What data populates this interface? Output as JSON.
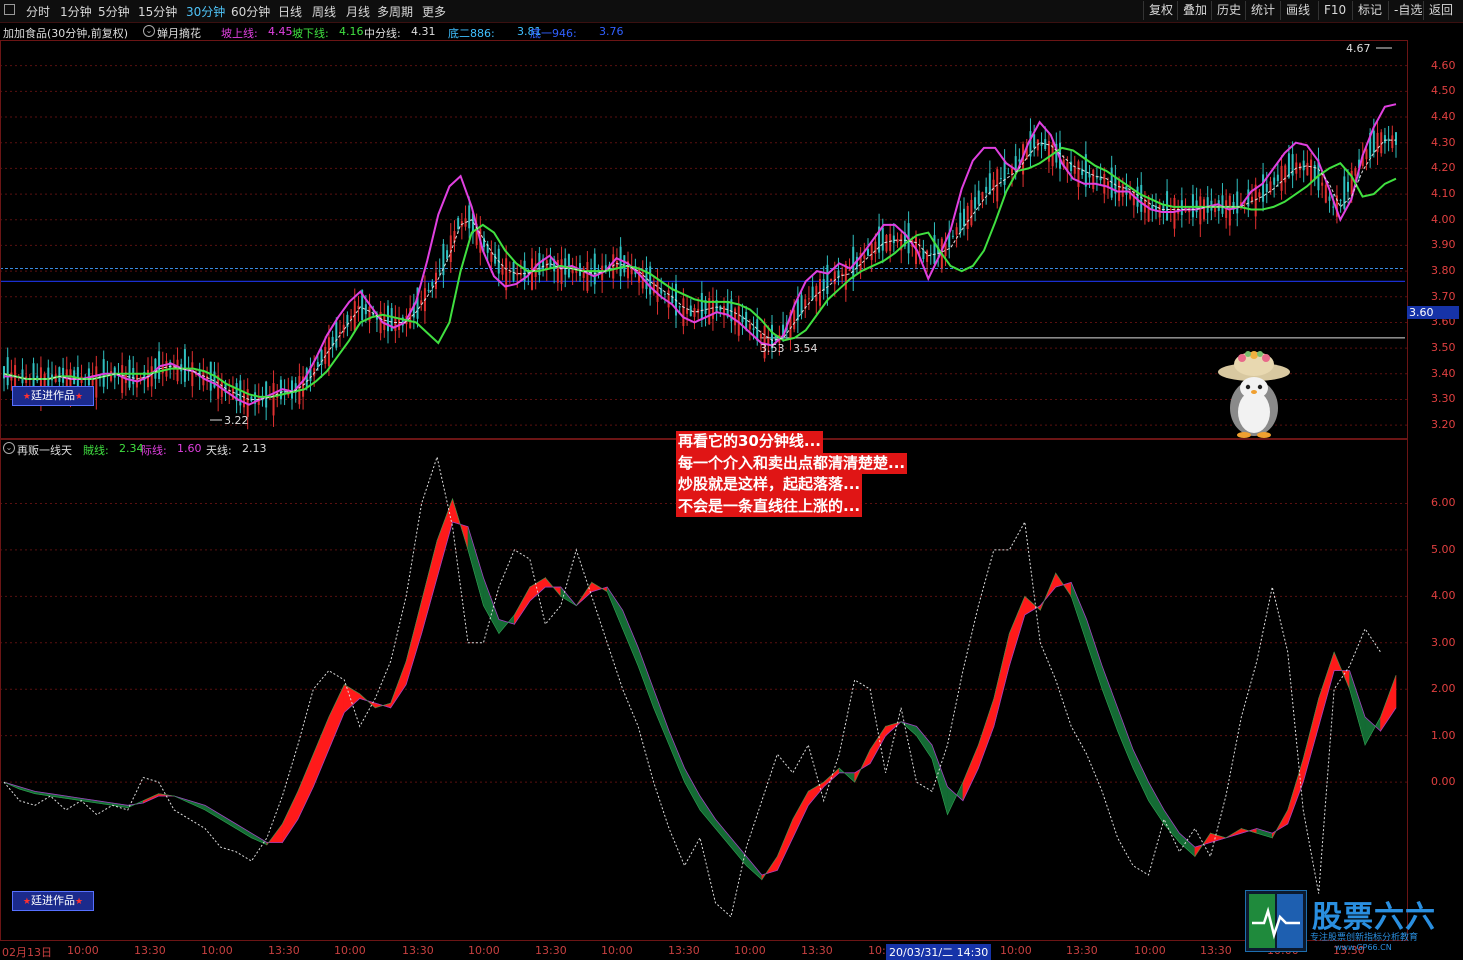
{
  "toolbar": {
    "periods": [
      "分时",
      "1分钟",
      "5分钟",
      "15分钟",
      "30分钟",
      "60分钟",
      "日线",
      "周线",
      "月线",
      "多周期",
      "更多"
    ],
    "active_period": "30分钟",
    "right_buttons": [
      "复权",
      "叠加",
      "历史",
      "统计",
      "画线",
      "F10",
      "标记",
      "-自选",
      "返回"
    ]
  },
  "info_bar": {
    "title": "加加食品(30分钟,前复权)",
    "indicator": "婵月摘花",
    "items": [
      {
        "label": "坡上线:",
        "value": "4.45",
        "color": "#e040e0"
      },
      {
        "label": "坡下线:",
        "value": "4.16",
        "color": "#40e040"
      },
      {
        "label": "中分线:",
        "value": "4.31",
        "color": "#dddddd"
      },
      {
        "label": "底二886:",
        "value": "3.81",
        "color": "#40c0ff"
      },
      {
        "label": "底一946:",
        "value": "3.76",
        "color": "#3060ff"
      }
    ]
  },
  "osc_info": {
    "title": "再贩一线天",
    "items": [
      {
        "label": "賊线:",
        "value": "2.34",
        "color": "#40e040"
      },
      {
        "label": "际线:",
        "value": "1.60",
        "color": "#e040e0"
      },
      {
        "label": "天线:",
        "value": "2.13",
        "color": "#dddddd"
      }
    ]
  },
  "annotation": [
    "再看它的30分钟线...",
    "每一个介入和卖出点都清清楚楚...",
    "炒股就是这样，起起落落...",
    "不会是一条直线往上涨的..."
  ],
  "brand_label": "廷进作品",
  "price_tag": "3.60",
  "high_label": "4.67",
  "low_label": "3.22",
  "mid_labels": [
    "3.53",
    "3.54"
  ],
  "logo": {
    "name": "股票六六",
    "subtitle": "专注股票创新指标分析教育",
    "url": "www.GP66.CN"
  },
  "colors": {
    "up": "#ff2020",
    "down": "#1a7a3a",
    "magenta": "#e040e0",
    "green": "#40e040",
    "white_dash": "#dddddd",
    "grid": "#6b1515",
    "blue_line": "#1a2fd0"
  },
  "chart_data": [
    {
      "type": "line",
      "title": "加加食品(30分钟,前复权)",
      "ylim": [
        3.15,
        4.7
      ],
      "y_ticks": [
        "4.60",
        "4.50",
        "4.40",
        "4.30",
        "4.20",
        "4.10",
        "4.00",
        "3.90",
        "3.80",
        "3.70",
        "3.60",
        "3.50",
        "3.40",
        "3.30",
        "3.20"
      ],
      "x_ticks": [
        "02月13日",
        "10:00",
        "13:30",
        "10:00",
        "13:30",
        "10:00",
        "13:30",
        "10:00",
        "13:30",
        "10:00",
        "13:30",
        "10:00",
        "13:30",
        "10:",
        "20/03/31/二 14:30",
        "10:00",
        "13:30",
        "10:00",
        "13:30",
        "10:00",
        "13:30",
        "10:00",
        "13:30",
        "10:00",
        "13:30"
      ],
      "series": [
        {
          "name": "坡上线",
          "color": "#e040e0",
          "values": [
            3.39,
            3.39,
            3.38,
            3.38,
            3.38,
            3.39,
            3.38,
            3.38,
            3.39,
            3.4,
            3.4,
            3.38,
            3.37,
            3.39,
            3.43,
            3.44,
            3.42,
            3.41,
            3.38,
            3.36,
            3.33,
            3.3,
            3.28,
            3.3,
            3.32,
            3.34,
            3.33,
            3.38,
            3.46,
            3.55,
            3.62,
            3.68,
            3.72,
            3.66,
            3.6,
            3.58,
            3.6,
            3.68,
            3.84,
            4.02,
            4.13,
            4.17,
            4.05,
            3.88,
            3.78,
            3.74,
            3.75,
            3.78,
            3.83,
            3.86,
            3.81,
            3.82,
            3.8,
            3.78,
            3.8,
            3.85,
            3.83,
            3.79,
            3.74,
            3.7,
            3.67,
            3.62,
            3.6,
            3.62,
            3.64,
            3.63,
            3.6,
            3.56,
            3.52,
            3.51,
            3.55,
            3.67,
            3.76,
            3.8,
            3.79,
            3.83,
            3.81,
            3.86,
            3.92,
            3.98,
            3.98,
            3.94,
            3.88,
            3.77,
            3.86,
            3.96,
            4.12,
            4.23,
            4.28,
            4.28,
            4.22,
            4.19,
            4.3,
            4.38,
            4.33,
            4.22,
            4.16,
            4.14,
            4.14,
            4.13,
            4.11,
            4.11,
            4.07,
            4.04,
            4.03,
            4.03,
            4.04,
            4.04,
            4.05,
            4.06,
            4.04,
            4.05,
            4.11,
            4.14,
            4.2,
            4.26,
            4.3,
            4.29,
            4.23,
            4.12,
            4.0,
            4.08,
            4.25,
            4.36,
            4.44,
            4.45
          ]
        },
        {
          "name": "坡下线",
          "color": "#40e040",
          "values": [
            3.4,
            3.39,
            3.38,
            3.38,
            3.38,
            3.39,
            3.39,
            3.38,
            3.38,
            3.39,
            3.4,
            3.4,
            3.4,
            3.4,
            3.41,
            3.42,
            3.42,
            3.42,
            3.41,
            3.39,
            3.36,
            3.34,
            3.32,
            3.31,
            3.31,
            3.32,
            3.33,
            3.34,
            3.37,
            3.41,
            3.47,
            3.53,
            3.6,
            3.62,
            3.63,
            3.62,
            3.61,
            3.6,
            3.56,
            3.52,
            3.6,
            3.8,
            3.95,
            3.98,
            3.95,
            3.88,
            3.83,
            3.8,
            3.8,
            3.81,
            3.82,
            3.81,
            3.8,
            3.8,
            3.8,
            3.81,
            3.82,
            3.81,
            3.79,
            3.76,
            3.73,
            3.71,
            3.69,
            3.68,
            3.68,
            3.68,
            3.67,
            3.65,
            3.61,
            3.56,
            3.53,
            3.54,
            3.57,
            3.63,
            3.69,
            3.73,
            3.77,
            3.8,
            3.82,
            3.84,
            3.87,
            3.91,
            3.94,
            3.95,
            3.88,
            3.82,
            3.8,
            3.82,
            3.88,
            3.99,
            4.11,
            4.19,
            4.2,
            4.22,
            4.25,
            4.28,
            4.27,
            4.24,
            4.21,
            4.19,
            4.16,
            4.13,
            4.1,
            4.08,
            4.06,
            4.05,
            4.05,
            4.05,
            4.05,
            4.05,
            4.05,
            4.05,
            4.04,
            4.04,
            4.05,
            4.07,
            4.1,
            4.13,
            4.17,
            4.2,
            4.22,
            4.17,
            4.09,
            4.1,
            4.14,
            4.16
          ]
        },
        {
          "name": "中分线",
          "color": "#dddddd",
          "values": [
            3.4,
            3.39,
            3.38,
            3.38,
            3.38,
            3.39,
            3.38,
            3.38,
            3.38,
            3.39,
            3.4,
            3.39,
            3.38,
            3.39,
            3.42,
            3.43,
            3.42,
            3.41,
            3.39,
            3.37,
            3.34,
            3.32,
            3.3,
            3.3,
            3.31,
            3.33,
            3.33,
            3.36,
            3.41,
            3.48,
            3.54,
            3.6,
            3.66,
            3.64,
            3.61,
            3.6,
            3.6,
            3.64,
            3.7,
            3.77,
            3.86,
            3.98,
            4.0,
            3.93,
            3.86,
            3.81,
            3.79,
            3.79,
            3.81,
            3.83,
            3.81,
            3.81,
            3.8,
            3.79,
            3.8,
            3.83,
            3.82,
            3.8,
            3.76,
            3.73,
            3.7,
            3.66,
            3.64,
            3.65,
            3.66,
            3.65,
            3.63,
            3.6,
            3.56,
            3.53,
            3.54,
            3.6,
            3.66,
            3.71,
            3.74,
            3.78,
            3.79,
            3.83,
            3.87,
            3.91,
            3.92,
            3.92,
            3.91,
            3.86,
            3.87,
            3.89,
            3.96,
            4.02,
            4.08,
            4.13,
            4.16,
            4.19,
            4.25,
            4.3,
            4.29,
            4.25,
            4.21,
            4.19,
            4.17,
            4.16,
            4.13,
            4.12,
            4.09,
            4.06,
            4.04,
            4.04,
            4.04,
            4.04,
            4.05,
            4.05,
            4.05,
            4.05,
            4.07,
            4.09,
            4.12,
            4.16,
            4.2,
            4.21,
            4.2,
            4.14,
            4.05,
            4.09,
            4.19,
            4.26,
            4.31,
            4.31
          ]
        }
      ]
    },
    {
      "type": "area",
      "title": "再贩一线天",
      "ylim": [
        -3.4,
        7.0
      ],
      "y_ticks": [
        "6.00",
        "5.00",
        "4.00",
        "3.00",
        "2.00",
        "1.00",
        "0.00"
      ],
      "series": [
        {
          "name": "賊线",
          "color": "#40e040",
          "values": [
            0.0,
            -0.15,
            -0.25,
            -0.3,
            -0.35,
            -0.4,
            -0.45,
            -0.5,
            -0.55,
            -0.4,
            -0.25,
            -0.3,
            -0.45,
            -0.6,
            -0.8,
            -1.0,
            -1.2,
            -1.35,
            -0.9,
            -0.2,
            0.6,
            1.4,
            2.1,
            1.9,
            1.6,
            1.7,
            2.6,
            3.9,
            5.2,
            6.1,
            5.0,
            3.8,
            3.2,
            3.6,
            4.2,
            4.4,
            4.0,
            3.8,
            4.3,
            4.1,
            3.3,
            2.5,
            1.6,
            0.8,
            0.0,
            -0.6,
            -1.0,
            -1.4,
            -1.8,
            -2.1,
            -1.6,
            -0.8,
            -0.2,
            0.0,
            0.3,
            0.0,
            0.7,
            1.2,
            1.3,
            1.0,
            0.5,
            -0.7,
            0.0,
            0.8,
            1.8,
            3.2,
            4.0,
            3.7,
            4.5,
            4.0,
            3.0,
            2.0,
            1.1,
            0.3,
            -0.4,
            -0.9,
            -1.3,
            -1.6,
            -1.1,
            -1.2,
            -1.0,
            -1.1,
            -1.2,
            -0.6,
            0.5,
            1.8,
            2.8,
            2.0,
            0.8,
            1.4,
            2.3
          ]
        },
        {
          "name": "际线",
          "color": "#e040e0",
          "values": [
            0.0,
            -0.1,
            -0.2,
            -0.25,
            -0.3,
            -0.35,
            -0.4,
            -0.45,
            -0.5,
            -0.45,
            -0.3,
            -0.3,
            -0.4,
            -0.5,
            -0.7,
            -0.9,
            -1.1,
            -1.3,
            -1.3,
            -0.8,
            -0.1,
            0.7,
            1.5,
            1.8,
            1.7,
            1.6,
            2.1,
            3.2,
            4.4,
            5.6,
            5.5,
            4.4,
            3.5,
            3.4,
            3.9,
            4.2,
            4.2,
            3.8,
            4.1,
            4.2,
            3.7,
            2.9,
            2.0,
            1.1,
            0.3,
            -0.3,
            -0.8,
            -1.2,
            -1.6,
            -2.0,
            -1.9,
            -1.2,
            -0.5,
            -0.1,
            0.2,
            0.2,
            0.4,
            1.0,
            1.3,
            1.2,
            0.8,
            -0.1,
            -0.4,
            0.3,
            1.2,
            2.5,
            3.6,
            3.8,
            4.2,
            4.3,
            3.5,
            2.5,
            1.6,
            0.7,
            0.0,
            -0.6,
            -1.1,
            -1.4,
            -1.3,
            -1.2,
            -1.1,
            -1.0,
            -1.1,
            -0.9,
            0.0,
            1.2,
            2.4,
            2.4,
            1.4,
            1.1,
            1.6
          ]
        },
        {
          "name": "天线",
          "color": "#dddddd",
          "values": [
            0.0,
            -0.4,
            -0.5,
            -0.3,
            -0.6,
            -0.4,
            -0.7,
            -0.5,
            -0.6,
            0.1,
            0.0,
            -0.6,
            -0.8,
            -1.0,
            -1.4,
            -1.5,
            -1.7,
            -1.2,
            -0.3,
            0.8,
            2.0,
            2.4,
            2.2,
            1.2,
            1.8,
            2.6,
            4.0,
            6.0,
            7.0,
            5.5,
            3.0,
            3.0,
            4.2,
            5.0,
            4.8,
            3.4,
            3.8,
            5.0,
            4.0,
            3.0,
            2.0,
            1.2,
            0.0,
            -1.0,
            -1.8,
            -1.2,
            -2.6,
            -2.9,
            -1.4,
            -0.4,
            0.6,
            0.2,
            0.8,
            -0.4,
            0.6,
            2.2,
            2.0,
            0.2,
            1.6,
            0.0,
            -0.2,
            0.8,
            2.4,
            3.8,
            5.0,
            5.0,
            5.6,
            3.0,
            2.2,
            1.2,
            0.6,
            -0.2,
            -1.2,
            -1.8,
            -2.0,
            -0.8,
            -1.5,
            -1.0,
            -1.6,
            -0.3,
            1.4,
            2.6,
            4.2,
            2.8,
            -0.6,
            -2.4,
            2.0,
            2.5,
            3.3,
            2.8
          ]
        }
      ]
    }
  ]
}
